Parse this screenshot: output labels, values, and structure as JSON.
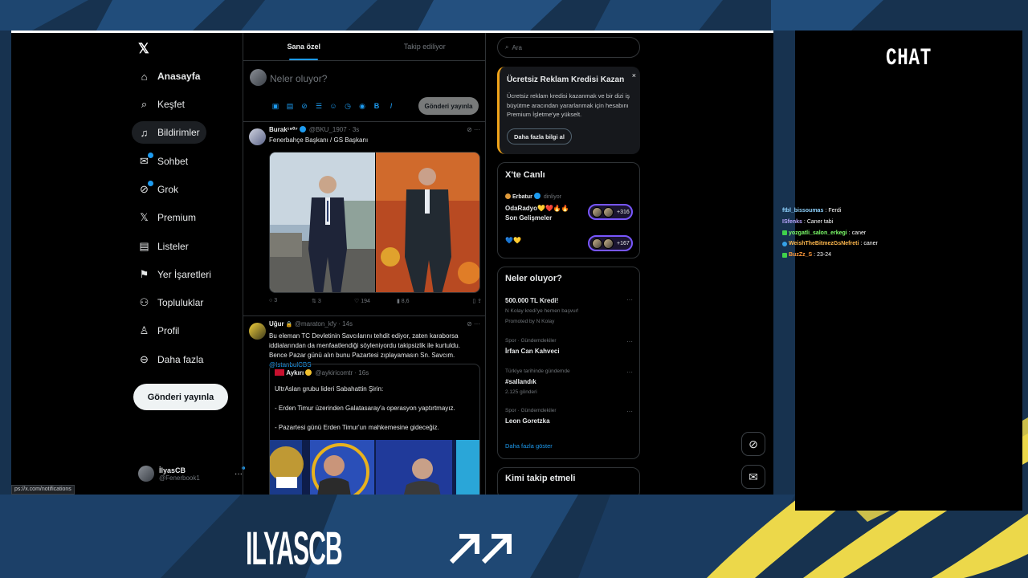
{
  "overlay": {
    "chat_title": "CHAT",
    "brand_name": "ILYASCB",
    "colors": {
      "background": "#17324f",
      "accent_yellow": "#ecd84a",
      "blue_stripe": "#24507f"
    }
  },
  "nav": {
    "items": [
      {
        "label": "Anasayfa",
        "icon": "home-icon",
        "active": true
      },
      {
        "label": "Keşfet",
        "icon": "search-icon"
      },
      {
        "label": "Bildirimler",
        "icon": "bell-icon",
        "hover": true
      },
      {
        "label": "Sohbet",
        "icon": "mail-icon",
        "badge": true
      },
      {
        "label": "Grok",
        "icon": "grok-icon",
        "badge": true
      },
      {
        "label": "Premium",
        "icon": "x-logo-icon"
      },
      {
        "label": "Listeler",
        "icon": "list-icon"
      },
      {
        "label": "Yer İşaretleri",
        "icon": "bookmark-icon"
      },
      {
        "label": "Topluluklar",
        "icon": "communities-icon"
      },
      {
        "label": "Profil",
        "icon": "person-icon"
      },
      {
        "label": "Daha fazla",
        "icon": "more-circle-icon"
      }
    ],
    "post_button": "Gönderi yayınla",
    "account": {
      "name": "İlyasCB",
      "handle": "@Fenerbook1"
    },
    "status_url": "ps://x.com/notifications"
  },
  "timeline": {
    "tabs": [
      {
        "label": "Sana özel",
        "active": true
      },
      {
        "label": "Takip ediliyor"
      }
    ],
    "compose": {
      "placeholder": "Neler oluyor?",
      "button": "Gönderi yayınla"
    },
    "tweets": [
      {
        "name": "Burak¹⁹⁰⁷",
        "handle": "@BKU_1907 · 3s",
        "text": "Fenerbahçe Başkanı / GS Başkanı",
        "actions": {
          "reply": "3",
          "retweet": "3",
          "like": "194",
          "views": "8,6"
        }
      },
      {
        "name": "Uğur",
        "handle": "@maraton_kfy · 14s",
        "text": "Bu eleman TC Devletinin Savcılarını tehdit ediyor, zaten karaborsa iddialarından da menfaatlendiği söyleniyordu takipsizlik ile kurtuldu. Bence Pazar günü alın bunu Pazartesi zıplayamasın Sn. Savcım.",
        "mention": "@IstanbulCBS",
        "quote": {
          "name": "Aykırı",
          "handle": "@aykiricomtr · 16s",
          "lines": [
            "UltrAslan grubu lideri Sabahattin Şirin:",
            "- Erden Timur üzerinden Galatasaray'a operasyon yaptırtmayız.",
            "- Pazartesi günü Erden Timur'un mahkemesine gideceğiz."
          ]
        }
      }
    ]
  },
  "sidebar": {
    "search_placeholder": "Ara",
    "promo": {
      "title": "Ücretsiz Reklam Kredisi Kazan",
      "body": "Ücretsiz reklam kredisi kazanmak ve bir dizi iş büyütme aracından yararlanmak için hesabını Premium İşletme'ye yükselt.",
      "button": "Daha fazla bilgi al",
      "close": "×"
    },
    "live": {
      "title": "X'te Canlı",
      "host": "Erbatur",
      "host_status": "dinliyor",
      "spaces": [
        {
          "title_line1": "OdaRadyo💛❤️🔥🔥",
          "title_line2": "Son Gelişmeler",
          "count": "+316"
        },
        {
          "title_line1": "💙💛",
          "title_line2": "",
          "count": "+167"
        }
      ]
    },
    "trends": {
      "title": "Neler oluyor?",
      "items": [
        {
          "name": "500.000 TL Kredi!",
          "sub": "N Kolay kredi'ye hemen başvur!",
          "meta": "Promoted by N Kolay"
        },
        {
          "meta": "Spor · Gündemdekiler",
          "name": "İrfan Can Kahveci"
        },
        {
          "meta": "Türkiye tarihinde gündemde",
          "name": "#sallandık",
          "sub": "2.125 gönderi"
        },
        {
          "meta": "Spor · Gündemdekiler",
          "name": "Leon Goretzka"
        }
      ],
      "show_more": "Daha fazla göster"
    },
    "follow_title": "Kimi takip etmeli"
  },
  "chat": {
    "messages": [
      {
        "user": "ftbl_bissoumas",
        "text": "Ferdi",
        "color": "#8fd3ff",
        "icon": ""
      },
      {
        "user": "ISfenks",
        "text": "Caner tabi",
        "color": "#b9a7ff",
        "icon": ""
      },
      {
        "user": "yozgatli_salon_erkegi",
        "text": "caner",
        "color": "#7dff6b",
        "icon": "plus"
      },
      {
        "user": "WeishTheBitmezGsNefreti",
        "text": "caner",
        "color": "#ffb84d",
        "icon": "gem"
      },
      {
        "user": "BuzZz_S",
        "text": "23-24",
        "color": "#ff9a3c",
        "icon": "plus"
      }
    ]
  }
}
